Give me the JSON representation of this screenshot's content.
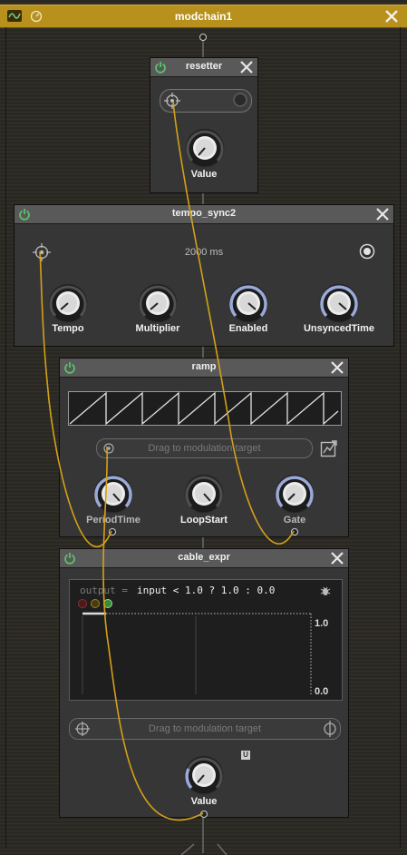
{
  "container": {
    "title": "modchain1"
  },
  "resetter": {
    "title": "resetter",
    "knob_label": "Value"
  },
  "tempo_sync": {
    "title": "tempo_sync2",
    "value_display": "2000 ms",
    "knobs": [
      "Tempo",
      "Multiplier",
      "Enabled",
      "UnsyncedTime"
    ]
  },
  "ramp": {
    "title": "ramp",
    "drag_target": "Drag to modulation target",
    "knobs": [
      "PeriodTime",
      "LoopStart",
      "Gate"
    ]
  },
  "cable_expr": {
    "title": "cable_expr",
    "expr_label": "output =",
    "expression": "input < 1.0 ? 1.0 : 0.0",
    "y_max": "1.0",
    "y_min": "0.0",
    "drag_target": "Drag to modulation target",
    "knob_label": "Value",
    "small_icon_text": "U"
  },
  "colors": {
    "cable": "#d4a018",
    "power": "#5ac06a",
    "header": "#b8901c",
    "accent": "#9aaad8"
  }
}
